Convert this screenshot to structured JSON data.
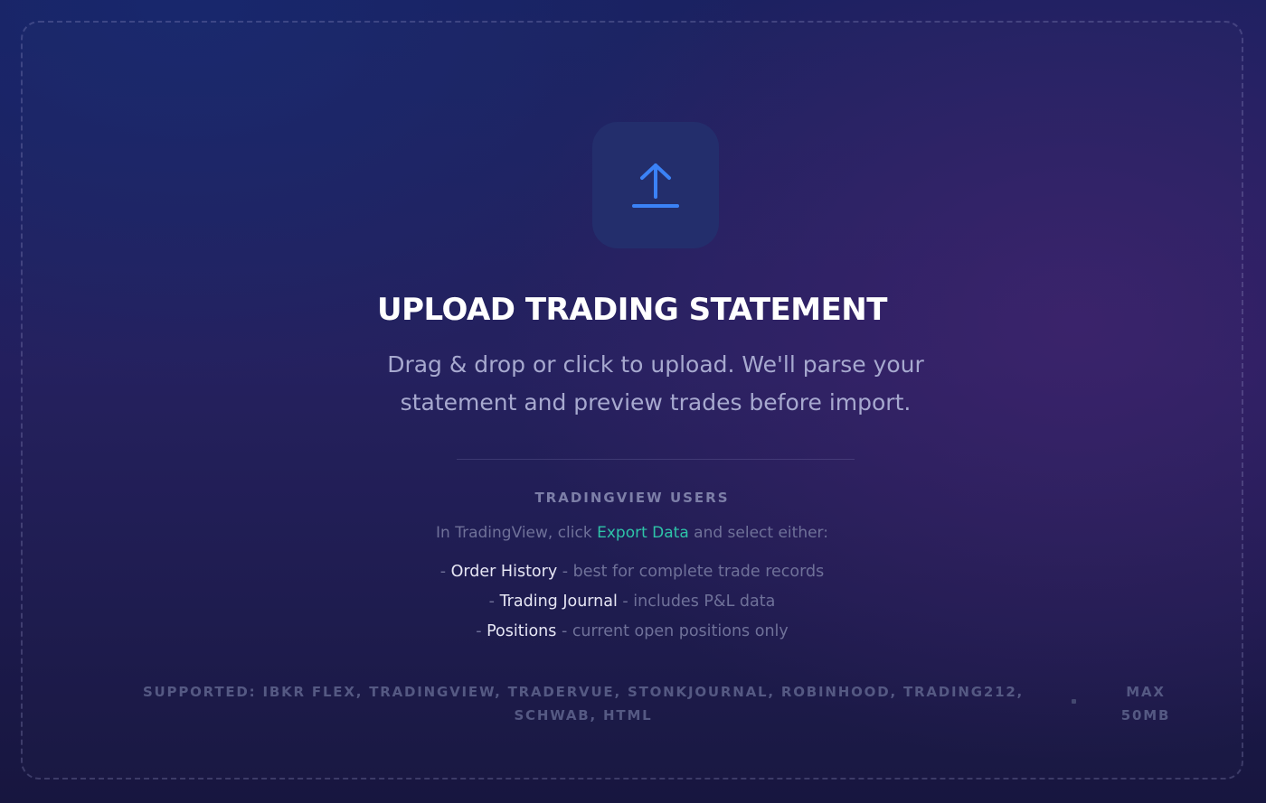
{
  "upload": {
    "icon": "upload-arrow-icon",
    "title": "UPLOAD TRADING STATEMENT",
    "subtitle": "Drag & drop or click to upload. We'll parse your statement and preview trades before import."
  },
  "tradingview": {
    "heading": "TRADINGVIEW USERS",
    "instruction_prefix": "In TradingView, click ",
    "instruction_link": "Export Data",
    "instruction_suffix": " and select either:",
    "options": [
      {
        "dash": "- ",
        "name": "Order History",
        "description": " - best for complete trade records"
      },
      {
        "dash": "- ",
        "name": "Trading Journal",
        "description": " - includes P&L data"
      },
      {
        "dash": "- ",
        "name": "Positions",
        "description": " - current open positions only"
      }
    ]
  },
  "footer": {
    "supported": "SUPPORTED: IBKR FLEX, TRADINGVIEW, TRADERVUE, STONKJOURNAL, ROBINHOOD, TRADING212, SCHWAB, HTML",
    "max_size": "MAX 50MB"
  },
  "colors": {
    "accent_blue": "#3b82f6",
    "link_teal": "#2ec4a8",
    "tile_bg": "#232e6c"
  }
}
